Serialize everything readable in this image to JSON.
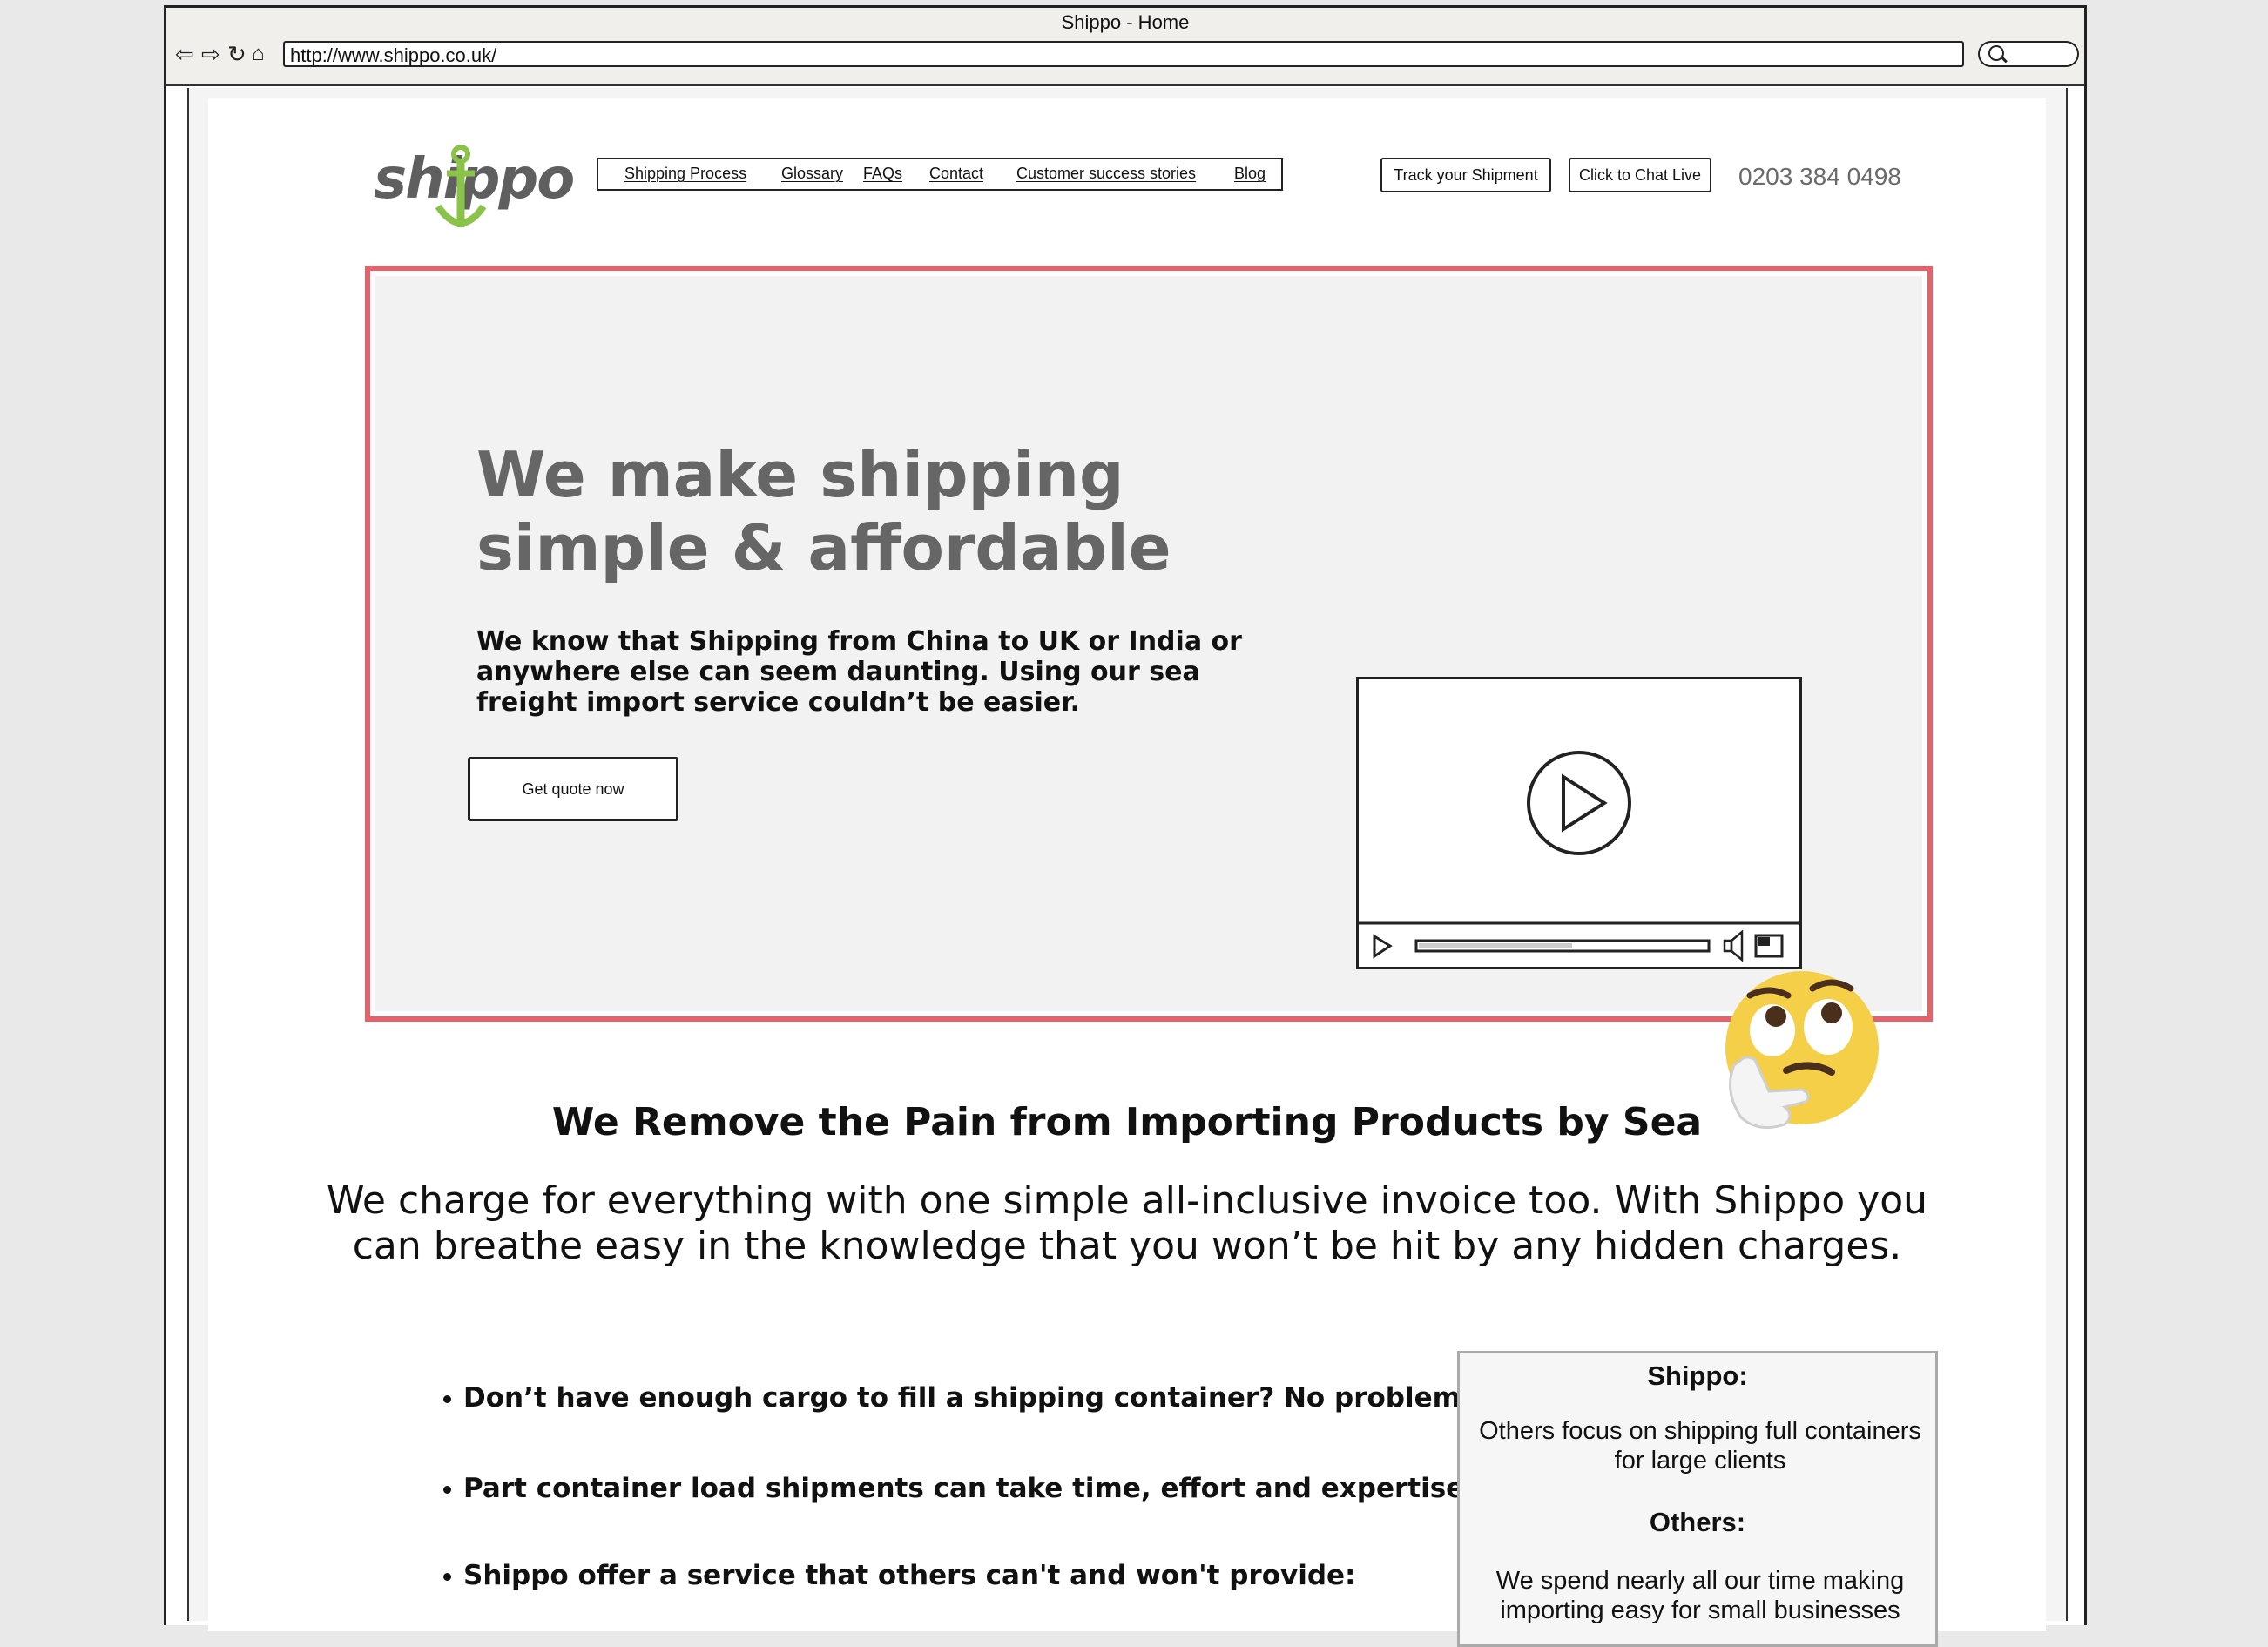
{
  "browser": {
    "window_title": "Shippo - Home",
    "url": "http://www.shippo.co.uk/"
  },
  "header": {
    "logo_text": "shippo",
    "nav": [
      "Shipping Process",
      "Glossary",
      "FAQs",
      "Contact",
      "Customer success stories",
      "Blog"
    ],
    "track_button": "Track your Shipment",
    "chat_button": "Click to Chat Live",
    "phone": "0203 384 0498"
  },
  "hero": {
    "title_line1": "We make shipping",
    "title_line2": "simple & affordable",
    "text": "We know that Shipping from China to UK or India or anywhere else can seem daunting.  Using our sea freight import service couldn’t be easier.",
    "cta": "Get quote now"
  },
  "section": {
    "heading": "We Remove the Pain from Importing Products by Sea",
    "text": "We charge for everything with one simple all-inclusive invoice too.  With Shippo you can breathe easy in the knowledge that you won’t be hit by any hidden charges.",
    "bullets": [
      "Don’t have enough cargo to fill a shipping container?  No problem.",
      "Part container load shipments can take time, effort and expertise.",
      "Shippo offer a service that others can't and won't provide:"
    ]
  },
  "comparison": {
    "shippo_title": "Shippo:",
    "shippo_text": "Others focus on shipping full containers for large clients",
    "others_title": "Others:",
    "others_text": "We spend nearly all our time making importing easy for small businesses"
  },
  "colors": {
    "hero_border": "#e8616a",
    "logo_anchor": "#8bc34a",
    "emoji": "#f5cf48"
  },
  "icons": [
    "back-arrow-icon",
    "forward-arrow-icon",
    "reload-icon",
    "home-icon",
    "search-icon",
    "play-icon",
    "volume-icon",
    "fullscreen-icon",
    "thinking-face-emoji"
  ]
}
